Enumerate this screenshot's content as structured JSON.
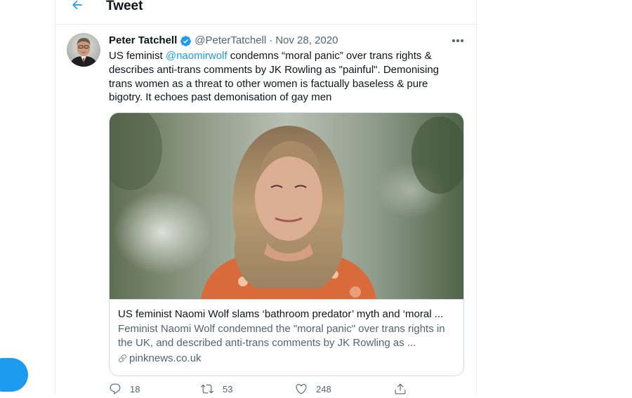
{
  "header": {
    "title": "Tweet"
  },
  "tweet": {
    "author_name": "Peter Tatchell",
    "author_handle": "@PeterTatchell",
    "separator": "·",
    "date": "Nov 28, 2020",
    "text_before": "US feminist ",
    "mention": "@naomirwolf",
    "text_after": " condemns “moral panic” over trans rights & describes anti-trans comments by JK Rowling as \"painful\". Demonising trans women as a threat to other women is factually baseless & pure bigotry. It echoes past demonisation of gay men"
  },
  "card": {
    "title": "US feminist Naomi Wolf slams ‘bathroom predator’ myth and ‘moral ...",
    "description": "Feminist Naomi Wolf condemned the \"moral panic\" over trans rights in the UK, and described anti-trans comments by JK Rowling as ...",
    "domain": "pinknews.co.uk"
  },
  "actions": {
    "replies": "18",
    "retweets": "53",
    "likes": "248"
  },
  "icons": [
    "back-arrow-icon",
    "verified-badge-icon",
    "more-icon",
    "link-icon",
    "reply-icon",
    "retweet-icon",
    "like-icon",
    "share-icon"
  ],
  "colors": {
    "accent": "#1d9bf0",
    "text": "#0f1419",
    "secondary": "#536471",
    "border": "#cfd9de"
  }
}
